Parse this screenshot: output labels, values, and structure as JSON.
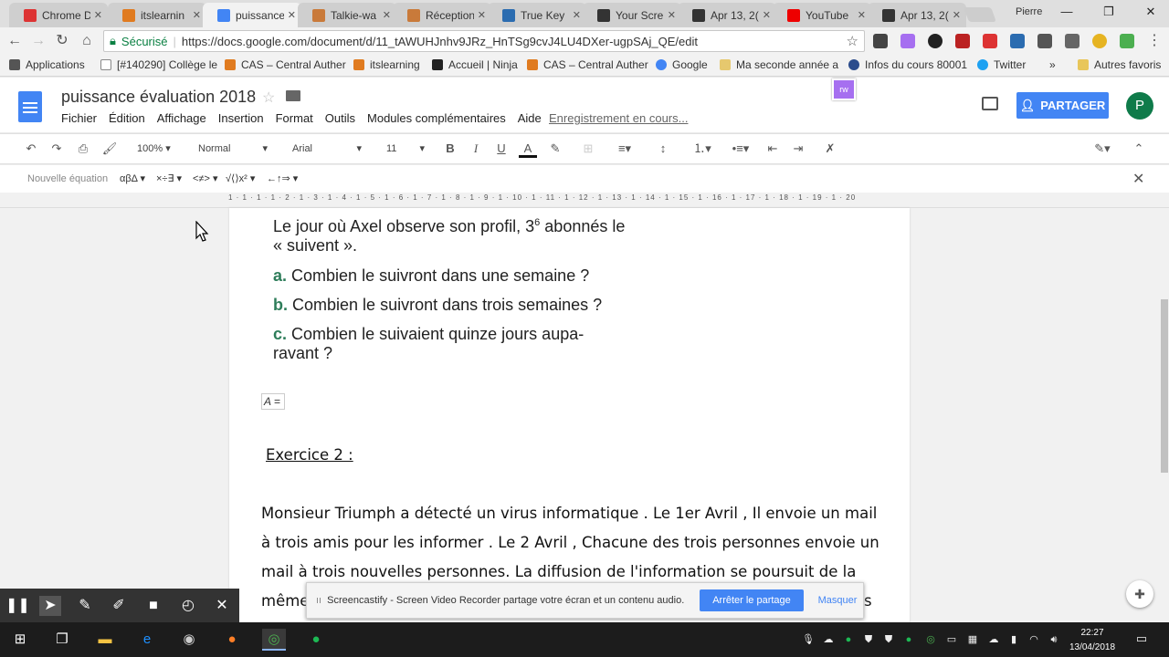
{
  "browser": {
    "tabs": [
      {
        "title": "Chrome D",
        "color": "#d33"
      },
      {
        "title": "itslearnin",
        "color": "#e07b20"
      },
      {
        "title": "puissance",
        "color": "#4285f4"
      },
      {
        "title": "Talkie-wa",
        "color": "#c97a3a"
      },
      {
        "title": "Réception",
        "color": "#c97a3a"
      },
      {
        "title": "True Key",
        "color": "#2b6cb0"
      },
      {
        "title": "Your Scre",
        "color": "#333"
      },
      {
        "title": "Apr 13, 2(",
        "color": "#333"
      },
      {
        "title": "YouTube",
        "color": "#e00"
      },
      {
        "title": "Apr 13, 2(",
        "color": "#333"
      }
    ],
    "user": "Pierre",
    "secure_label": "Sécurisé",
    "url": "https://docs.google.com/document/d/11_tAWUHJnhv9JRz_HnTSg9cvJ4LU4DXer-ugpSAj_QE/edit",
    "bookmarks": [
      "Applications",
      "[#140290] Collège le",
      "CAS – Central Auther",
      "itslearning",
      "Accueil | Ninja",
      "CAS – Central Auther",
      "Google",
      "Ma seconde année a",
      "Infos du cours 80001",
      "Twitter"
    ],
    "bookmarks_more": "»",
    "other_bookmarks": "Autres favoris"
  },
  "docs": {
    "title": "puissance évaluation 2018",
    "menu": [
      "Fichier",
      "Édition",
      "Affichage",
      "Insertion",
      "Format",
      "Outils",
      "Modules complémentaires",
      "Aide"
    ],
    "saving_status": "Enregistrement en cours...",
    "share_label": "PARTAGER",
    "avatar_letter": "P",
    "addon_label": "rw",
    "toolbar": {
      "zoom": "100%",
      "style": "Normal",
      "font": "Arial",
      "size": "11"
    },
    "equation_bar": {
      "label": "Nouvelle équation",
      "groups": [
        "αβΔ",
        "×÷∃",
        "<≠>",
        "√⟨⟩x²",
        "←↑⇒"
      ]
    },
    "ruler": "1 · 1 · 1 · 1 · 2 · 1 · 3 · 1 · 4 · 1 · 5 · 1 · 6 · 1 · 7 · 1 · 8 · 1 · 9 · 1 · 10 · 1 · 11 · 1 · 12 · 1 · 13 · 1 · 14 · 1 · 15 · 1 · 16 · 1 · 17 · 1 · 18 · 1 · 19 · 1 · 20"
  },
  "document": {
    "intro_line1": "Le jour où Axel observe son profil, 3",
    "intro_exp": "6",
    "intro_line1_end": " abonnés le",
    "intro_line2": "« suivent ».",
    "q_a_label": "a.",
    "q_a": "Combien le suivront dans une semaine ?",
    "q_b_label": "b.",
    "q_b": "Combien le suivront dans trois semaines ?",
    "q_c_label": "c.",
    "q_c_line1": "Combien   le   suivaient   quinze   jours   aupa-",
    "q_c_line2": "ravant ?",
    "equation": "A =",
    "exercise_title": "Exercice 2 :",
    "para_line1": "Monsieur Triumph a détecté un virus informatique . Le 1er Avril , Il envoie un mail",
    "para_line2": "à trois amis pour les informer . Le 2 Avril , Chacune des trois personnes envoie un",
    "para_line3": "mail à trois nouvelles personnes. La diffusion de l'information se poursuit de la",
    "para_line4_start": "même",
    "para_line4_end": "s"
  },
  "screencastify": {
    "message": "Screencastify - Screen Video Recorder partage votre écran et un contenu audio.",
    "stop_label": "Arrêter le partage",
    "hide_label": "Masquer"
  },
  "taskbar": {
    "time": "22:27",
    "date": "13/04/2018"
  }
}
